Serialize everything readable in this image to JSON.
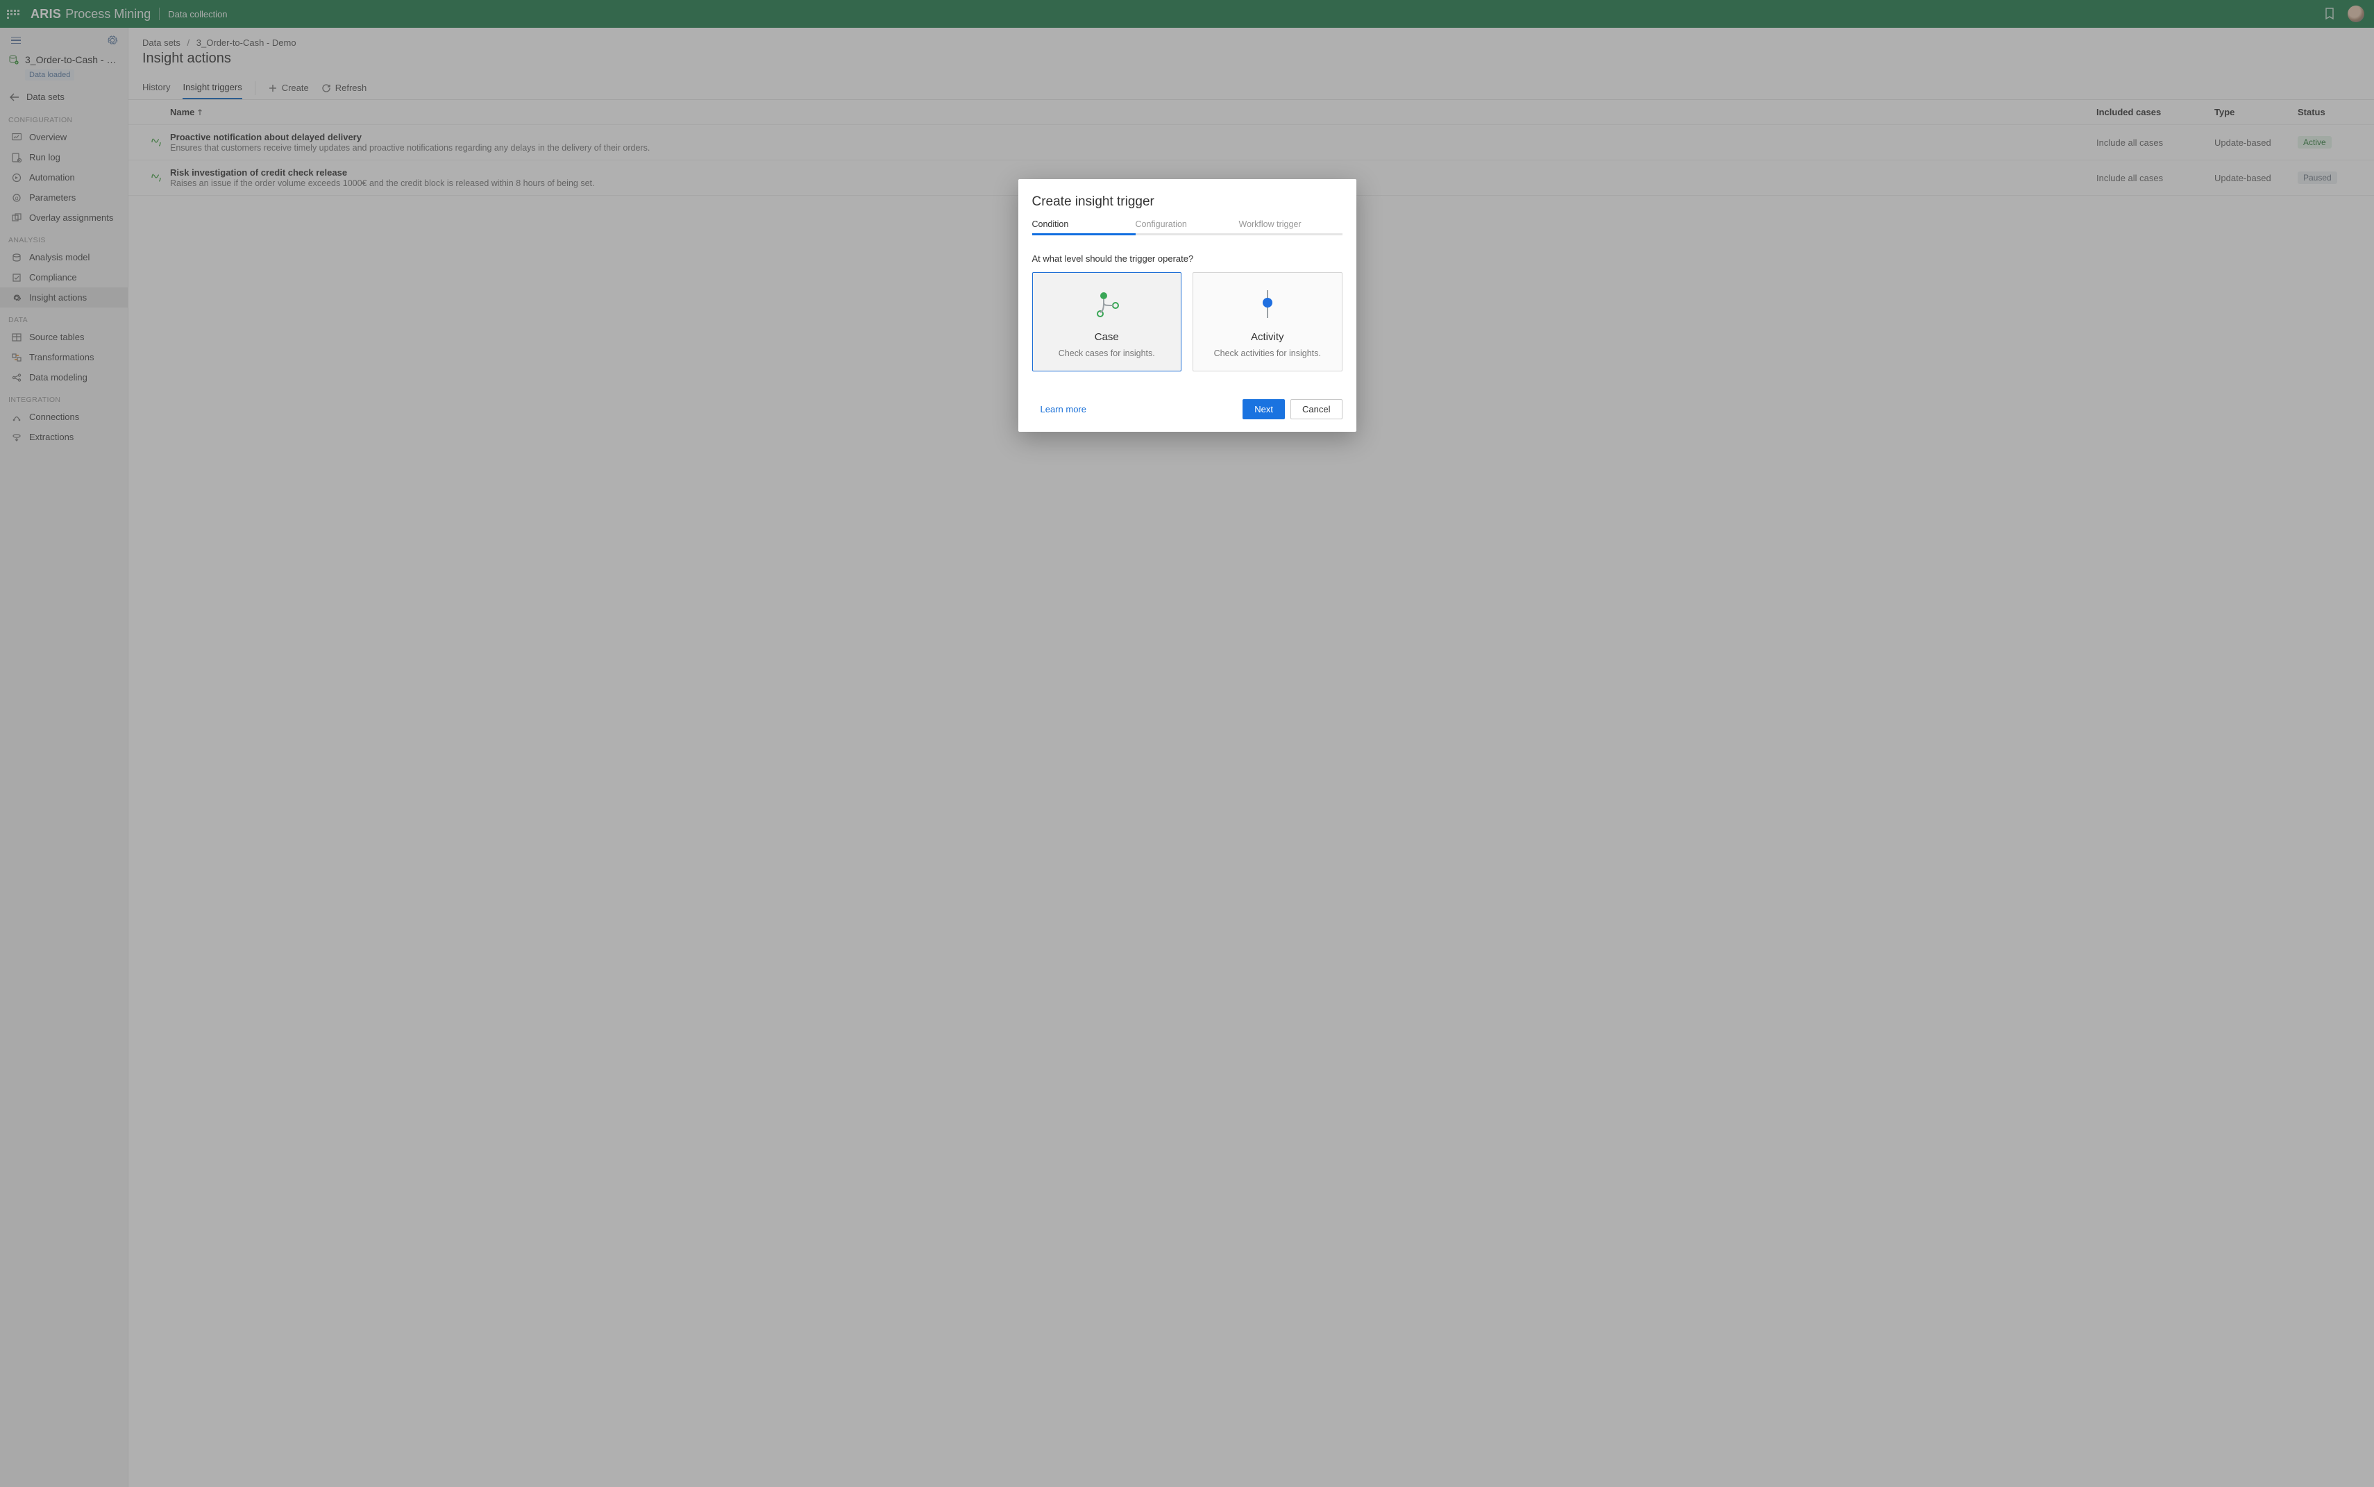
{
  "topbar": {
    "brand_a": "ARIS",
    "brand_b": "Process Mining",
    "context": "Data collection"
  },
  "sidebar": {
    "dataset": {
      "name": "3_Order-to-Cash - D…",
      "status_badge": "Data loaded"
    },
    "back": "Data sets",
    "sections": {
      "config_label": "CONFIGURATION",
      "config": [
        "Overview",
        "Run log",
        "Automation",
        "Parameters",
        "Overlay assignments"
      ],
      "analysis_label": "ANALYSIS",
      "analysis": [
        "Analysis model",
        "Compliance",
        "Insight actions"
      ],
      "data_label": "DATA",
      "data": [
        "Source tables",
        "Transformations",
        "Data modeling"
      ],
      "integration_label": "INTEGRATION",
      "integration": [
        "Connections",
        "Extractions"
      ]
    }
  },
  "main": {
    "crumbs": [
      "Data sets",
      "3_Order-to-Cash - Demo"
    ],
    "title": "Insight actions",
    "tabs": {
      "history": "History",
      "triggers": "Insight triggers"
    },
    "actions": {
      "create": "Create",
      "refresh": "Refresh"
    },
    "columns": {
      "name": "Name",
      "inc": "Included cases",
      "type": "Type",
      "status": "Status"
    },
    "rows": [
      {
        "title": "Proactive notification about delayed delivery",
        "desc": "Ensures that customers receive timely updates and proactive notifications regarding any delays in the delivery of their orders.",
        "inc": "Include all cases",
        "type": "Update-based",
        "status": "Active",
        "status_class": "active"
      },
      {
        "title": "Risk investigation of credit check release",
        "desc": "Raises an issue if the order volume exceeds 1000€ and the credit block is released within 8 hours of being set.",
        "inc": "Include all cases",
        "type": "Update-based",
        "status": "Paused",
        "status_class": "paused"
      }
    ]
  },
  "modal": {
    "title": "Create insight trigger",
    "steps": [
      "Condition",
      "Configuration",
      "Workflow trigger"
    ],
    "question": "At what level should the trigger operate?",
    "cards": [
      {
        "title": "Case",
        "desc": "Check cases for insights."
      },
      {
        "title": "Activity",
        "desc": "Check activities for insights."
      }
    ],
    "learn_more": "Learn more",
    "next": "Next",
    "cancel": "Cancel"
  }
}
